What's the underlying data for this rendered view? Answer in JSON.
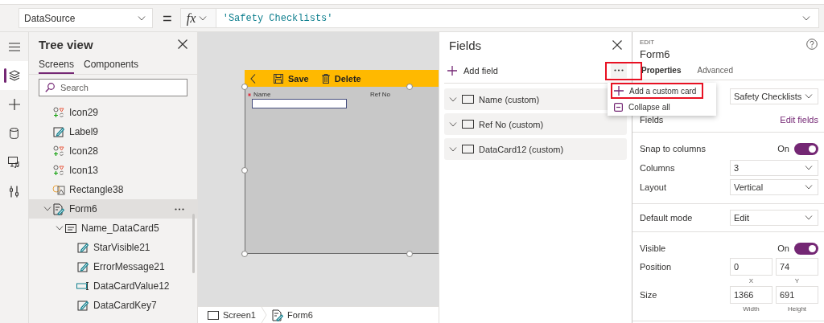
{
  "formula_bar": {
    "property": "DataSource",
    "equals": "=",
    "fx": "fx",
    "formula": "'Safety Checklists'"
  },
  "rail": [
    {
      "kind": "menu",
      "selected": false
    },
    {
      "kind": "layers",
      "selected": true
    },
    {
      "kind": "insert",
      "selected": false
    },
    {
      "kind": "data",
      "selected": false
    },
    {
      "kind": "media",
      "selected": false
    },
    {
      "kind": "tools",
      "selected": false
    }
  ],
  "tree_view": {
    "title": "Tree view",
    "tabs": [
      {
        "label": "Screens",
        "selected": true
      },
      {
        "label": "Components",
        "selected": false
      }
    ],
    "search": {
      "placeholder": "Search"
    },
    "items": [
      {
        "label": "Icon29",
        "kind": "icon",
        "selected": false
      },
      {
        "label": "Label9",
        "kind": "label",
        "selected": false
      },
      {
        "label": "Icon28",
        "kind": "icon",
        "selected": false
      },
      {
        "label": "Icon13",
        "kind": "icon",
        "selected": false
      },
      {
        "label": "Rectangle38",
        "kind": "shape",
        "selected": false
      },
      {
        "label": "Form6",
        "kind": "form",
        "selected": true,
        "expanded": true,
        "children": [
          {
            "label": "Name_DataCard5",
            "kind": "card",
            "selected": false,
            "expanded": true,
            "children": [
              {
                "label": "StarVisible21",
                "kind": "label",
                "selected": false
              },
              {
                "label": "ErrorMessage21",
                "kind": "label",
                "selected": false
              },
              {
                "label": "DataCardValue12",
                "kind": "input",
                "selected": false
              },
              {
                "label": "DataCardKey7",
                "kind": "label",
                "selected": false
              }
            ]
          }
        ]
      }
    ]
  },
  "canvas": {
    "form": {
      "toolbar": [
        {
          "label": "Save",
          "kind": "save"
        },
        {
          "label": "Delete",
          "kind": "delete"
        }
      ],
      "fields": [
        {
          "label": "Name",
          "required": true,
          "kind": "text"
        },
        {
          "label": "Ref No",
          "required": false,
          "kind": "empty"
        }
      ]
    },
    "breadcrumb": [
      {
        "label": "Screen1",
        "kind": "screen"
      },
      {
        "label": "Form6",
        "kind": "form"
      }
    ]
  },
  "fields_panel": {
    "title": "Fields",
    "add_label": "Add field",
    "more_button": {
      "highlighted": true
    },
    "fields": [
      {
        "label": "Name (custom)"
      },
      {
        "label": "Ref No (custom)"
      },
      {
        "label": "DataCard12 (custom)"
      }
    ]
  },
  "menu": {
    "items": [
      {
        "label": "Add a custom card",
        "kind": "add",
        "highlighted": true
      },
      {
        "label": "Collapse all",
        "kind": "collapse",
        "highlighted": false
      }
    ]
  },
  "properties": {
    "section": "EDIT",
    "title": "Form6",
    "tabs": [
      {
        "label": "Properties",
        "selected": true
      },
      {
        "label": "Advanced",
        "selected": false
      }
    ],
    "sections": [
      {
        "rows": [
          {
            "kind": "dropdown",
            "value": "Safety Checklists"
          },
          {
            "kind": "link",
            "label": "Fields",
            "link": "Edit fields"
          }
        ]
      },
      {
        "rows": [
          {
            "kind": "toggle",
            "label": "Snap to columns",
            "state": "On",
            "on": true
          },
          {
            "kind": "dropdown",
            "label": "Columns",
            "value": "3"
          },
          {
            "kind": "dropdown",
            "label": "Layout",
            "value": "Vertical"
          }
        ]
      },
      {
        "rows": [
          {
            "kind": "dropdown",
            "label": "Default mode",
            "value": "Edit"
          }
        ]
      },
      {
        "rows": [
          {
            "kind": "toggle",
            "label": "Visible",
            "state": "On",
            "on": true
          },
          {
            "kind": "pair",
            "label": "Position",
            "values": [
              {
                "value": "0",
                "caption": "X"
              },
              {
                "value": "74",
                "caption": "Y"
              }
            ]
          },
          {
            "kind": "pair",
            "label": "Size",
            "values": [
              {
                "value": "1366",
                "caption": "Width"
              },
              {
                "value": "691",
                "caption": "Height"
              }
            ]
          }
        ]
      }
    ]
  }
}
